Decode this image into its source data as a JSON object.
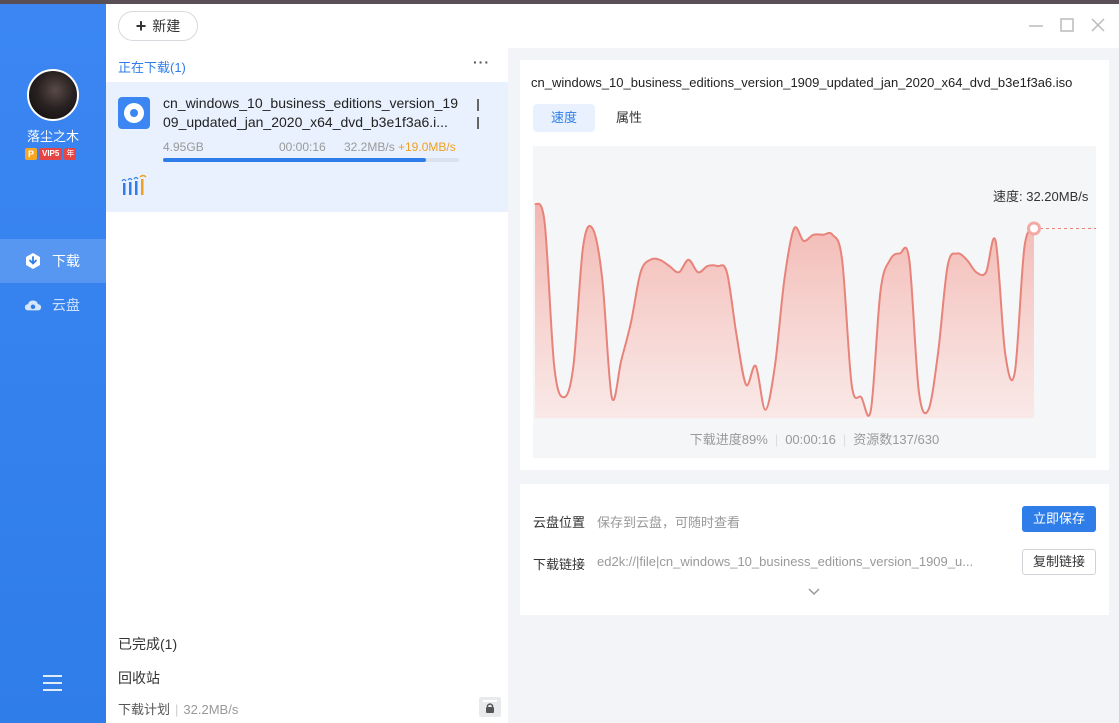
{
  "user": {
    "name": "落尘之木",
    "vip_badge": "VIP5",
    "year_badge": "年",
    "p_badge": "P"
  },
  "nav": [
    {
      "label": "下载",
      "icon": "download-icon"
    },
    {
      "label": "云盘",
      "icon": "cloud-icon"
    }
  ],
  "toolbar": {
    "new_label": "新建"
  },
  "list": {
    "header": "正在下载(1)",
    "item": {
      "filename": "cn_windows_10_business_editions_version_1909_updated_jan_2020_x64_dvd_b3e1f3a6.i...",
      "size": "4.95GB",
      "elapsed": "00:00:16",
      "speed": "32.2MB/s",
      "accel": "+19.0MB/s",
      "progress": 0.89
    },
    "completed": "已完成(1)",
    "recycle": "回收站",
    "plan_label": "下载计划",
    "plan_speed": "32.2MB/s"
  },
  "detail": {
    "title": "cn_windows_10_business_editions_version_1909_updated_jan_2020_x64_dvd_b3e1f3a6.iso",
    "tabs": [
      "速度",
      "属性"
    ],
    "speed_label": "速度: 32.20MB/s",
    "progress_text": "下载进度89%",
    "time_text": "00:00:16",
    "sources_text": "资源数137/630"
  },
  "cloud": {
    "location_label": "云盘位置",
    "location_value": "保存到云盘，可随时查看",
    "save_button": "立即保存",
    "link_label": "下载链接",
    "link_value": "ed2k://|file|cn_windows_10_business_editions_version_1909_u...",
    "copy_button": "复制链接"
  },
  "colors": {
    "accent": "#2f7de9",
    "chart_line": "#e8837a",
    "chart_fill": "#f6c6c1"
  },
  "chart_data": {
    "type": "area",
    "title": "",
    "xlabel": "",
    "ylabel": "",
    "current_speed": 32.2,
    "values": [
      34,
      31,
      8,
      3,
      8,
      27,
      30,
      22,
      3,
      9,
      15,
      23,
      25,
      25,
      24,
      23,
      25,
      23,
      24,
      24,
      23,
      13,
      5,
      8,
      1,
      8,
      22,
      30,
      28,
      29,
      29,
      29,
      25,
      5,
      3,
      1,
      20,
      25,
      26,
      25,
      4,
      1,
      10,
      24,
      26,
      25,
      23,
      23,
      28,
      10,
      7,
      27,
      30
    ],
    "ylim": [
      0,
      40
    ]
  }
}
